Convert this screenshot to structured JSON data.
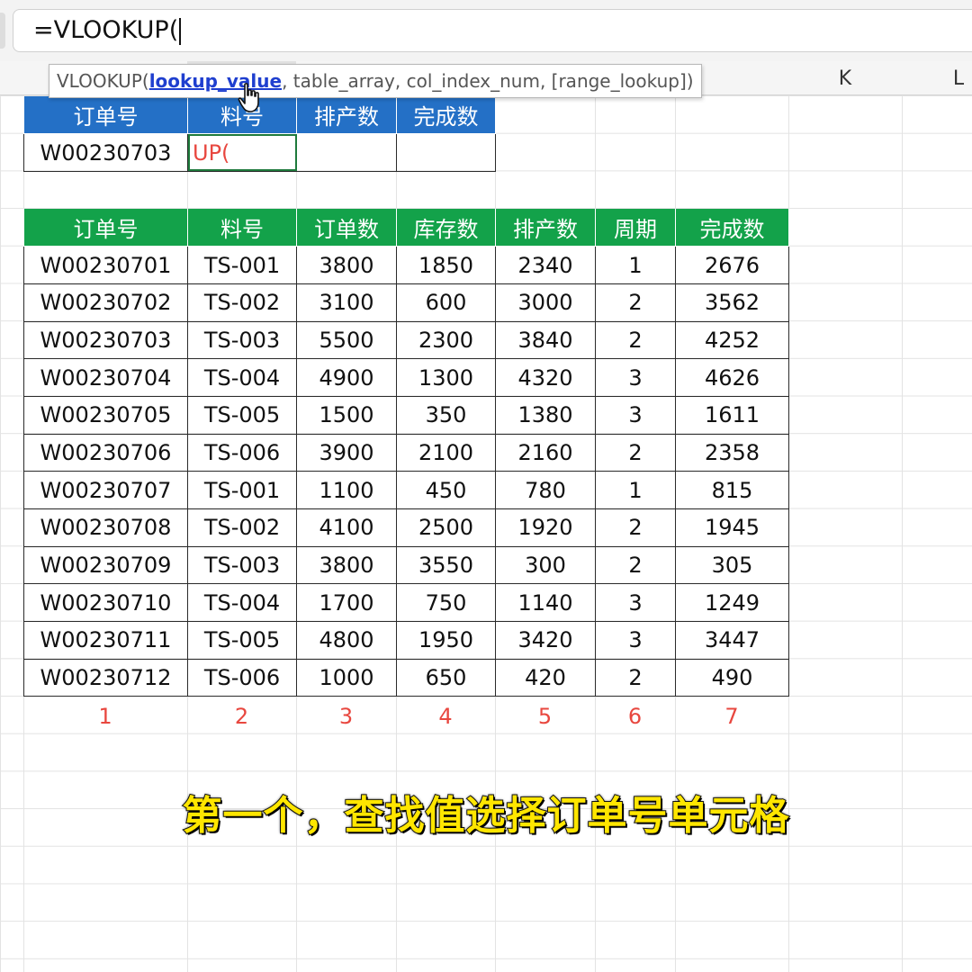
{
  "formula_bar": {
    "text": "=VLOOKUP("
  },
  "tooltip": {
    "func": "VLOOKUP(",
    "arg_active": "lookup_value",
    "rest": ", table_array, col_index_num, [range_lookup])"
  },
  "column_letters": [
    "K",
    "L"
  ],
  "lookup_table": {
    "headers": [
      "订单号",
      "料号",
      "排产数",
      "完成数"
    ],
    "row": [
      "W00230703",
      "UP(",
      "",
      ""
    ]
  },
  "data_table": {
    "headers": [
      "订单号",
      "料号",
      "订单数",
      "库存数",
      "排产数",
      "周期",
      "完成数"
    ],
    "rows": [
      [
        "W00230701",
        "TS-001",
        "3800",
        "1850",
        "2340",
        "1",
        "2676"
      ],
      [
        "W00230702",
        "TS-002",
        "3100",
        "600",
        "3000",
        "2",
        "3562"
      ],
      [
        "W00230703",
        "TS-003",
        "5500",
        "2300",
        "3840",
        "2",
        "4252"
      ],
      [
        "W00230704",
        "TS-004",
        "4900",
        "1300",
        "4320",
        "3",
        "4626"
      ],
      [
        "W00230705",
        "TS-005",
        "1500",
        "350",
        "1380",
        "3",
        "1611"
      ],
      [
        "W00230706",
        "TS-006",
        "3900",
        "2100",
        "2160",
        "2",
        "2358"
      ],
      [
        "W00230707",
        "TS-001",
        "1100",
        "450",
        "780",
        "1",
        "815"
      ],
      [
        "W00230708",
        "TS-002",
        "4100",
        "2500",
        "1920",
        "2",
        "1945"
      ],
      [
        "W00230709",
        "TS-003",
        "3800",
        "3550",
        "300",
        "2",
        "305"
      ],
      [
        "W00230710",
        "TS-004",
        "1700",
        "750",
        "1140",
        "3",
        "1249"
      ],
      [
        "W00230711",
        "TS-005",
        "4800",
        "1950",
        "3420",
        "3",
        "3447"
      ],
      [
        "W00230712",
        "TS-006",
        "1000",
        "650",
        "420",
        "2",
        "490"
      ]
    ]
  },
  "column_indexes": [
    "1",
    "2",
    "3",
    "4",
    "5",
    "6",
    "7"
  ],
  "caption": "第一个，查找值选择订单号单元格",
  "colors": {
    "lookup_header": "#2470c6",
    "data_header": "#13a24a",
    "index_text": "#e8473f",
    "caption_text": "#ffe600",
    "tooltip_highlight": "#1f3fcf"
  },
  "icons": {
    "cursor": "hand-pointer-icon"
  }
}
